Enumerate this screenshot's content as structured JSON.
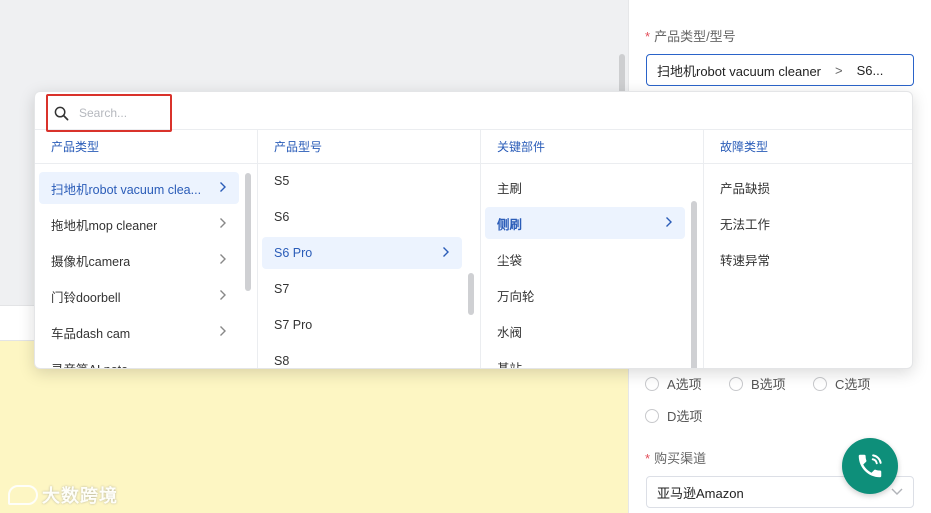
{
  "background": {
    "watermark": "大数跨境"
  },
  "right_panel": {
    "product_label": "产品类型/型号",
    "product_value_type": "扫地机robot vacuum cleaner",
    "product_value_sep": ">",
    "product_value_model": "S6...",
    "radio_options": [
      "A选项",
      "B选项",
      "C选项",
      "D选项"
    ],
    "channel_label": "购买渠道",
    "channel_value": "亚马逊Amazon",
    "required_mark": "*"
  },
  "dropdown": {
    "search_placeholder": "Search...",
    "columns": [
      {
        "header": "产品类型",
        "items": [
          {
            "label": "扫地机robot vacuum clea...",
            "has_children": true,
            "active": true
          },
          {
            "label": "拖地机mop cleaner",
            "has_children": true
          },
          {
            "label": "摄像机camera",
            "has_children": true
          },
          {
            "label": "门铃doorbell",
            "has_children": true
          },
          {
            "label": "车品dash cam",
            "has_children": true
          },
          {
            "label": "录音笔AI note",
            "has_children": false
          }
        ]
      },
      {
        "header": "产品型号",
        "items": [
          {
            "label": "S5",
            "has_children": false
          },
          {
            "label": "S6",
            "has_children": false
          },
          {
            "label": "S6 Pro",
            "has_children": true,
            "active": true
          },
          {
            "label": "S7",
            "has_children": false
          },
          {
            "label": "S7 Pro",
            "has_children": false
          },
          {
            "label": "S8",
            "has_children": false
          }
        ]
      },
      {
        "header": "关键部件",
        "items": [
          {
            "label": "主刷",
            "has_children": false
          },
          {
            "label": "侧刷",
            "has_children": true,
            "active": true,
            "bold": true
          },
          {
            "label": "尘袋",
            "has_children": false
          },
          {
            "label": "万向轮",
            "has_children": false
          },
          {
            "label": "水阀",
            "has_children": false
          },
          {
            "label": "基站",
            "has_children": false
          }
        ]
      },
      {
        "header": "故障类型",
        "items": [
          {
            "label": "产品缺损",
            "has_children": false
          },
          {
            "label": "无法工作",
            "has_children": false
          },
          {
            "label": "转速异常",
            "has_children": false
          }
        ]
      }
    ]
  }
}
